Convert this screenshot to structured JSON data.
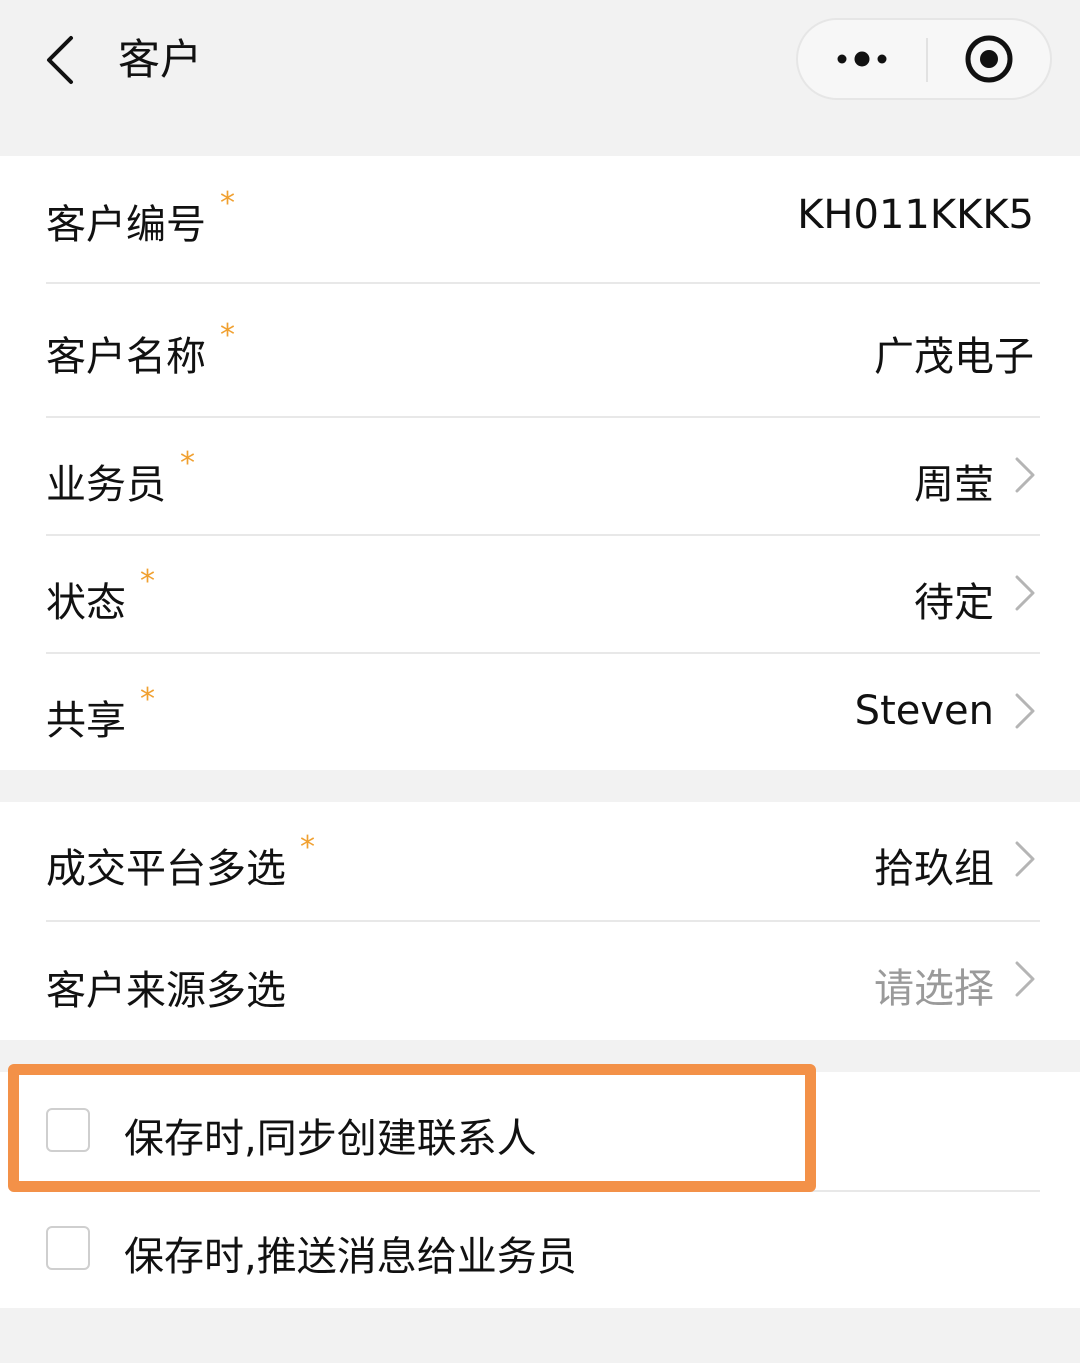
{
  "navbar": {
    "title": "客户",
    "back_icon": "chevron-left-icon",
    "more_icon": "more-dots-icon",
    "close_icon": "target-circle-icon"
  },
  "form": {
    "required_mark": "*",
    "section1": [
      {
        "label": "客户编号",
        "value": "KH011KKK5",
        "required": true,
        "chevron": false
      },
      {
        "label": "客户名称",
        "value": "广茂电子",
        "required": true,
        "chevron": false
      },
      {
        "label": "业务员",
        "value": "周莹",
        "required": true,
        "chevron": true
      },
      {
        "label": "状态",
        "value": "待定",
        "required": true,
        "chevron": true
      },
      {
        "label": "共享",
        "value": "Steven",
        "required": true,
        "chevron": true
      }
    ],
    "section2": [
      {
        "label": "成交平台多选",
        "value": "拾玖组",
        "required": true,
        "chevron": true
      },
      {
        "label": "客户来源多选",
        "placeholder": "请选择",
        "required": false,
        "chevron": true
      }
    ],
    "options": [
      {
        "label": "保存时,同步创建联系人",
        "checked": false,
        "highlighted": true
      },
      {
        "label": "保存时,推送消息给业务员",
        "checked": false,
        "highlighted": false
      }
    ]
  },
  "colors": {
    "required_star": "#f0a030",
    "highlight_border": "#f39148",
    "placeholder": "#9a9a9a",
    "background": "#f2f2f2"
  }
}
